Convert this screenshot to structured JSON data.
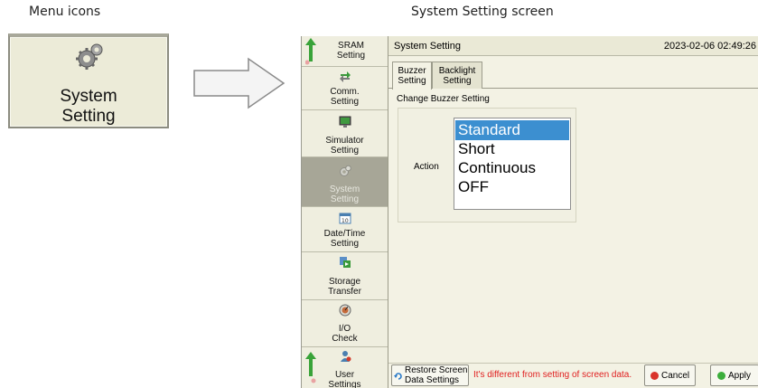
{
  "captions": {
    "left": "Menu icons",
    "right": "System Setting screen"
  },
  "menu_icon": {
    "label_line1": "System",
    "label_line2": "Setting",
    "icon": "gear-icon"
  },
  "sidebar": {
    "top": {
      "line1": "SRAM",
      "line2": "Setting",
      "icon": "scroll-up-arrow-icon"
    },
    "items": [
      {
        "line1": "Comm.",
        "line2": "Setting",
        "icon": "comm-arrows-icon",
        "active": false
      },
      {
        "line1": "Simulator",
        "line2": "Setting",
        "icon": "monitor-icon",
        "active": false
      },
      {
        "line1": "System",
        "line2": "Setting",
        "icon": "gear-icon",
        "active": true
      },
      {
        "line1": "Date/Time",
        "line2": "Setting",
        "icon": "calendar-icon",
        "active": false
      },
      {
        "line1": "Storage",
        "line2": "Transfer",
        "icon": "transfer-icon",
        "active": false
      },
      {
        "line1": "I/O",
        "line2": "Check",
        "icon": "gauge-icon",
        "active": false
      }
    ],
    "bottom": {
      "line1": "User",
      "line2": "Settings",
      "icon": "user-icon"
    }
  },
  "header": {
    "title": "System Setting",
    "datetime": "2023-02-06  02:49:26"
  },
  "tabs": [
    {
      "line1": "Buzzer",
      "line2": "Setting",
      "active": true
    },
    {
      "line1": "Backlight",
      "line2": "Setting",
      "active": false
    }
  ],
  "section": {
    "title": "Change Buzzer Setting",
    "field_label": "Action",
    "options": [
      "Standard",
      "Short",
      "Continuous",
      "OFF"
    ],
    "selected": "Standard"
  },
  "footer": {
    "restore_line1": "Restore Screen",
    "restore_line2": "Data Settings",
    "warning": "It's different from setting of screen data.",
    "cancel": "Cancel",
    "apply": "Apply"
  },
  "colors": {
    "selection": "#3c8fd0",
    "warning": "#e01e1e",
    "active_item": "#a7a697",
    "cancel_icon": "#d9342b",
    "apply_icon": "#3cae3c"
  }
}
